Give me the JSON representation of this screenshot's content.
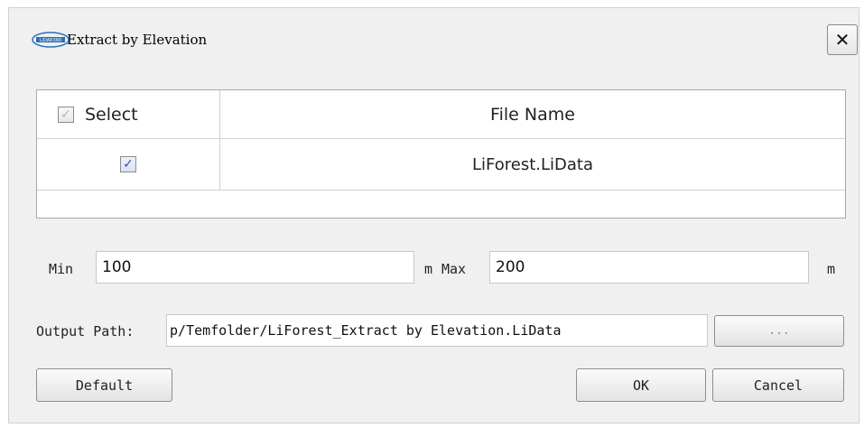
{
  "title": "Extract by Elevation",
  "logo_text": "LiDAR360",
  "close_label": "✕",
  "table": {
    "headers": {
      "select": "Select",
      "file_name": "File Name"
    },
    "rows": [
      {
        "checked": true,
        "file_name": "LiForest.LiData"
      }
    ]
  },
  "elevation": {
    "min_label": "Min",
    "min_value": "100",
    "min_unit": "m",
    "max_label": "Max",
    "max_value": "200",
    "max_unit": "m"
  },
  "output": {
    "label": "Output Path:",
    "value": "p/Temfolder/LiForest_Extract by Elevation.LiData",
    "browse_label": "..."
  },
  "buttons": {
    "default": "Default",
    "ok": "OK",
    "cancel": "Cancel"
  },
  "colors": {
    "dialog_bg": "#f0f0f0",
    "logo_blue": "#2a6fb5"
  }
}
